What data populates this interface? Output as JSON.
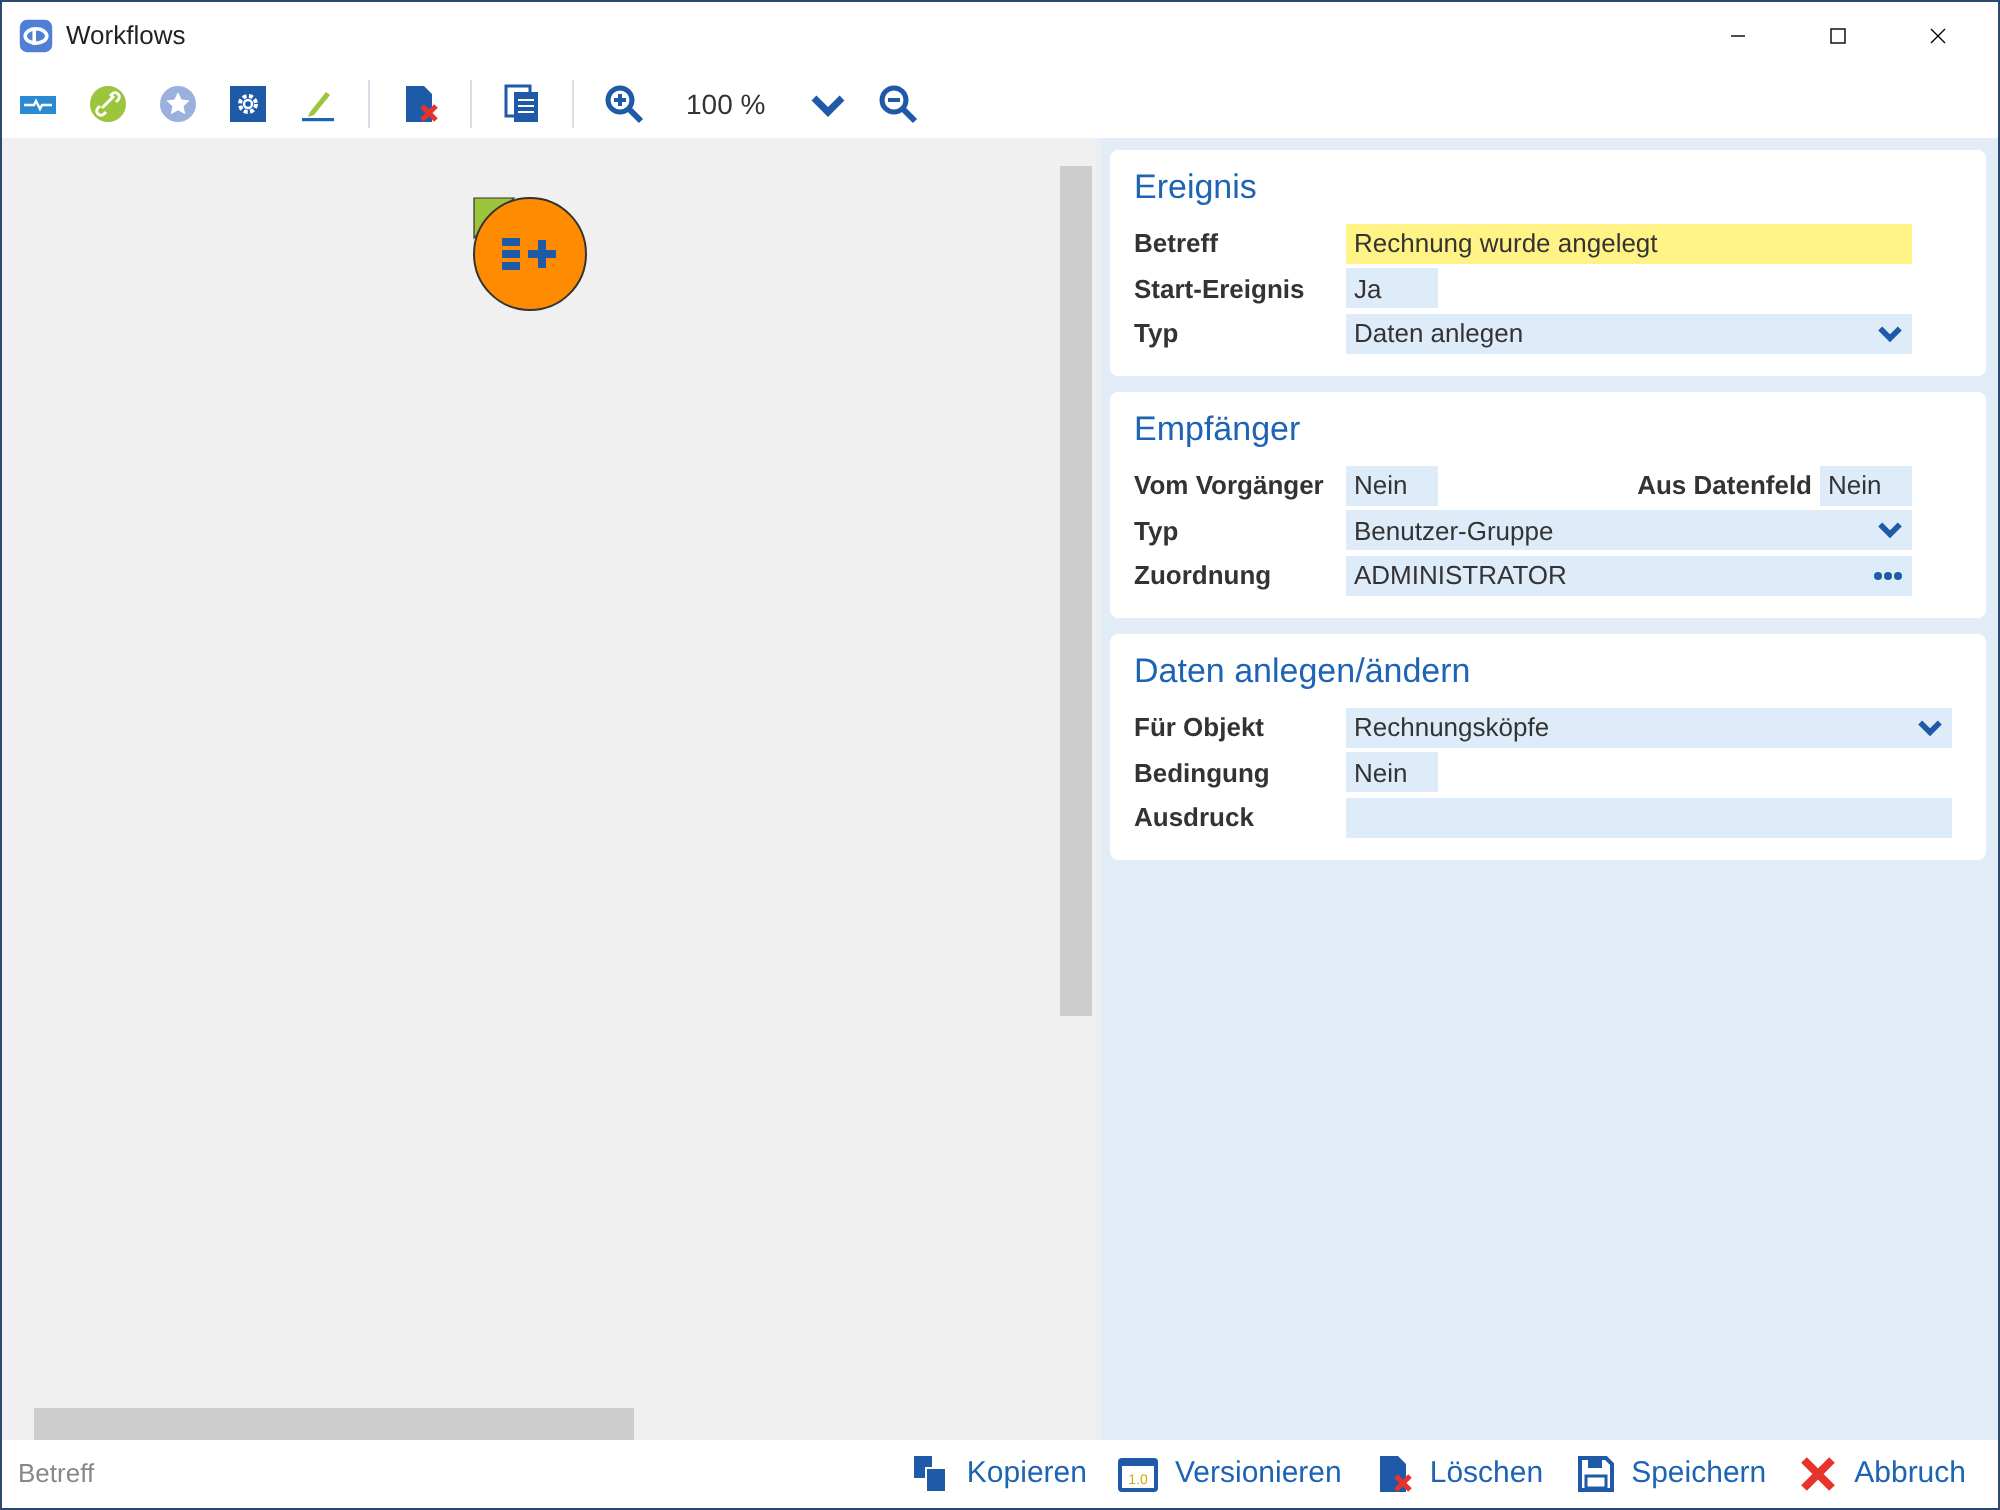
{
  "window": {
    "title": "Workflows"
  },
  "toolbar": {
    "items": [
      {
        "kind": "icon"
      },
      {
        "kind": "icon"
      },
      {
        "kind": "icon"
      },
      {
        "kind": "icon"
      },
      {
        "kind": "icon"
      },
      {
        "kind": "separator"
      },
      {
        "kind": "icon"
      },
      {
        "kind": "separator"
      },
      {
        "kind": "icon"
      },
      {
        "kind": "separator"
      },
      {
        "kind": "icon"
      },
      {
        "kind": "text",
        "text": "100 %"
      },
      {
        "kind": "icon"
      },
      {
        "kind": "icon"
      }
    ]
  },
  "sections": [
    {
      "title": "Ereignis",
      "full_width": false,
      "rows": [
        {
          "kind": "text",
          "label": "Betreff",
          "value": "Rechnung wurde angelegt",
          "highlighted": true
        },
        {
          "kind": "short",
          "label": "Start-Ereignis",
          "value": "Ja",
          "highlighted": false
        },
        {
          "kind": "dropdown",
          "label": "Typ",
          "value": "Daten anlegen",
          "highlighted": false
        }
      ]
    },
    {
      "title": "Empfänger",
      "full_width": false,
      "rows": [
        {
          "kind": "pair",
          "label": "Vom Vorgänger",
          "value": "Nein",
          "label_2": "Aus Datenfeld",
          "value_2": "Nein",
          "highlighted": false
        },
        {
          "kind": "dropdown",
          "label": "Typ",
          "value": "Benutzer-Gruppe",
          "highlighted": false
        },
        {
          "kind": "ellipsis",
          "label": "Zuordnung",
          "value": "ADMINISTRATOR",
          "highlighted": false
        }
      ]
    },
    {
      "title": "Daten anlegen/ändern",
      "full_width": true,
      "rows": [
        {
          "kind": "dropdown",
          "label": "Für Objekt",
          "value": "Rechnungsköpfe",
          "highlighted": false
        },
        {
          "kind": "short",
          "label": "Bedingung",
          "value": "Nein",
          "highlighted": false
        },
        {
          "kind": "text",
          "label": "Ausdruck",
          "highlighted": false
        }
      ]
    }
  ],
  "status_bar": {
    "text": "Betreff"
  },
  "footer_buttons": [
    {
      "label": "Kopieren"
    },
    {
      "label": "Versionieren",
      "icon_text": "1.0"
    },
    {
      "label": "Löschen"
    },
    {
      "label": "Speichern"
    },
    {
      "label": "Abbruch"
    }
  ]
}
